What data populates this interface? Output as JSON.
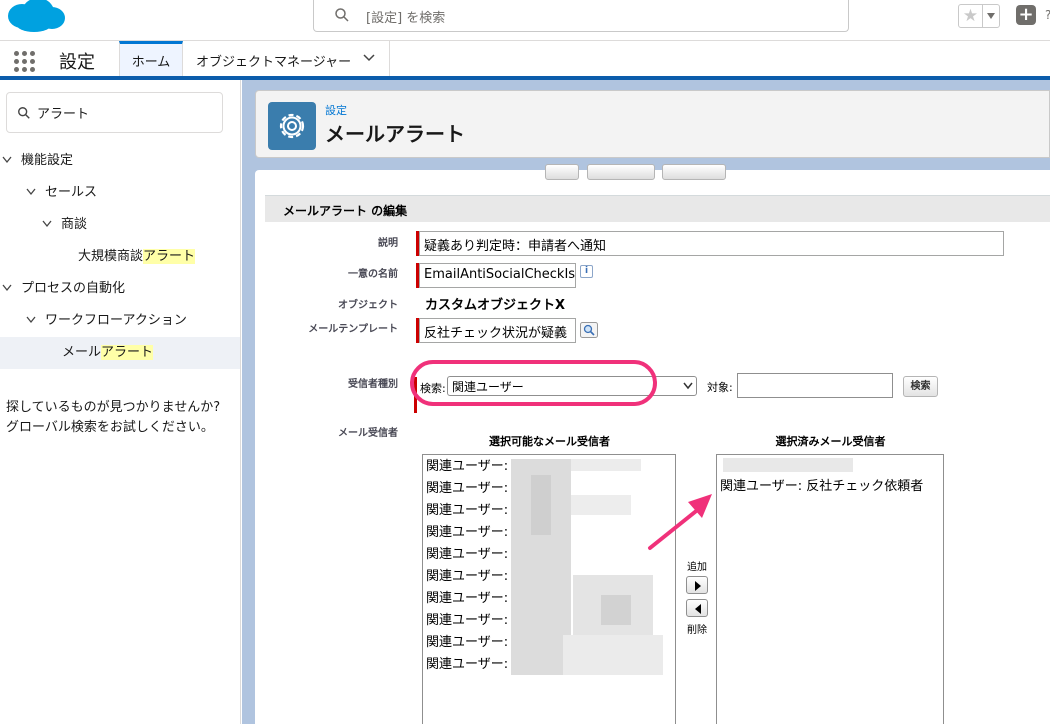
{
  "topbar": {
    "search_placeholder": "[設定] を検索"
  },
  "nav": {
    "app_name": "設定",
    "tabs": [
      {
        "label": "ホーム"
      },
      {
        "label": "オブジェクトマネージャー"
      }
    ]
  },
  "sidebar": {
    "quick_find_value": "アラート",
    "tree": [
      {
        "label": "機能設定"
      },
      {
        "label": "セールス"
      },
      {
        "label": "商談"
      },
      {
        "label_pre": "大規模商談",
        "label_hl": "アラート"
      },
      {
        "label": "プロセスの自動化"
      },
      {
        "label": "ワークフローアクション"
      },
      {
        "label_pre": "メール",
        "label_hl": "アラート"
      }
    ],
    "not_found_line1": "探しているものが見つかりませんか?",
    "not_found_line2": "グローバル検索をお試しください。"
  },
  "header": {
    "breadcrumb": "設定",
    "title": "メールアラート"
  },
  "form": {
    "section_title": "メールアラート の編集",
    "description_label": "説明",
    "description_value": "疑義あり判定時：申請者へ通知",
    "unique_name_label": "一意の名前",
    "unique_name_value": "EmailAntiSocialCheckIs",
    "info_glyph": "i",
    "object_label": "オブジェクト",
    "object_value": "カスタムオブジェクトX",
    "template_label": "メールテンプレート",
    "template_value": "反社チェック状況が疑義",
    "recipient_type_label": "受信者種別",
    "search_label": "検索:",
    "search_selected": "関連ユーザー",
    "target_label": "対象:",
    "target_value": "",
    "find_button": "検索",
    "recipients_label": "メール受信者",
    "available_title": "選択可能なメール受信者",
    "selected_title": "選択済みメール受信者",
    "available_items": [
      "関連ユーザー:",
      "関連ユーザー:",
      "関連ユーザー:",
      "関連ユーザー:",
      "関連ユーザー:",
      "関連ユーザー:",
      "関連ユーザー:",
      "関連ユーザー:",
      "関連ユーザー:",
      "関連ユーザー:"
    ],
    "selected_items": [
      "関連ユーザー: 反社チェック依頼者"
    ],
    "add_label": "追加",
    "remove_label": "削除"
  },
  "colors": {
    "brand_blue": "#0176d3",
    "annotation_pink": "#f0317a",
    "required_red": "#cc0000"
  }
}
